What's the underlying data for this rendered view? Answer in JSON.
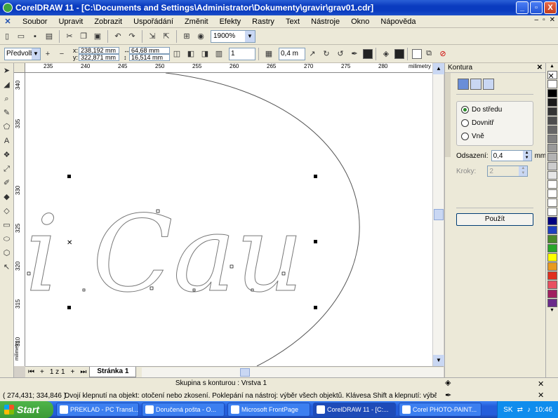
{
  "window": {
    "title": "CorelDRAW 11 - [C:\\Documents and Settings\\Administrator\\Dokumenty\\gravir\\grav01.cdr]",
    "minimize": "_",
    "maximize": "▫",
    "close": "X"
  },
  "menu": {
    "items": [
      "Soubor",
      "Upravit",
      "Zobrazit",
      "Uspořádání",
      "Změnit",
      "Efekty",
      "Rastry",
      "Text",
      "Nástroje",
      "Okno",
      "Nápověda"
    ]
  },
  "toolbar": {
    "zoom": "1900%"
  },
  "property_bar": {
    "preset": "Předvolb",
    "x": "238,192 mm",
    "y": "322,871 mm",
    "width": "64,68 mm",
    "height": "16,514 mm",
    "outline_width": "0,4 m",
    "count": "1"
  },
  "ruler": {
    "h_ticks": [
      "235",
      "240",
      "245",
      "250",
      "255",
      "260",
      "265",
      "270",
      "275",
      "280"
    ],
    "h_unit": "milimetry",
    "v_ticks": [
      "340",
      "335",
      "330",
      "325",
      "320",
      "315",
      "310"
    ],
    "v_unit": "milimetry"
  },
  "canvas": {
    "text_art": "i Cau"
  },
  "pages": {
    "counter": "1 z 1",
    "tab": "Stránka 1"
  },
  "docker": {
    "title": "Kontura",
    "options": [
      "Do středu",
      "Dovnitř",
      "Vně"
    ],
    "selected_option": "Do středu",
    "offset_label": "Odsazení:",
    "offset_value": "0,4",
    "offset_unit": "mm",
    "steps_label": "Kroky:",
    "steps_value": "2",
    "apply": "Použít"
  },
  "palette": {
    "colors": [
      "#ffffff",
      "#000000",
      "#1a1a1a",
      "#333333",
      "#4d4d4d",
      "#666666",
      "#808080",
      "#999999",
      "#b3b3b3",
      "#cccccc",
      "#e6e6e6",
      "#ffffff",
      "#ffffff",
      "#ffffff",
      "#ffffff",
      "#000080",
      "#1f3fbf",
      "#4a8a2a",
      "#2aa52a",
      "#ffff00",
      "#e89a20",
      "#e03020",
      "#e85060",
      "#a02060",
      "#6a2a8a"
    ]
  },
  "status": {
    "object_info": "Skupina s konturou : Vrstva 1",
    "coords": "( 274,431; 334,846 )",
    "hint": "Dvojí klepnutí na objekt: otočení nebo zkosení. Poklepání na nástroj: výběr všech objektů. Klávesa Shift a klepnutí: výběr více objektů. Klávesa ..."
  },
  "taskbar": {
    "start": "Start",
    "tasks": [
      "PREKLAD - PC Transl...",
      "Doručená pošta - O...",
      "Microsoft FrontPage",
      "CorelDRAW 11 - [C:...",
      "Corel PHOTO-PAINT..."
    ],
    "active_task": "CorelDRAW 11 - [C:...",
    "lang": "SK",
    "time": "10:46"
  }
}
